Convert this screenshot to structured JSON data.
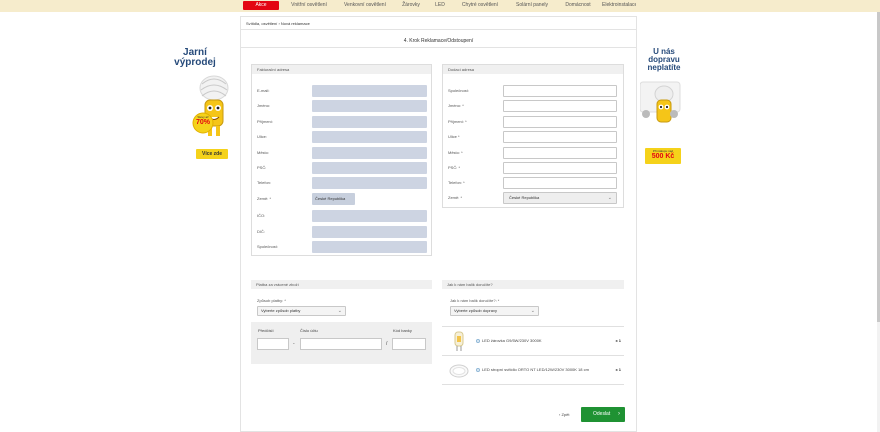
{
  "nav": {
    "items": [
      {
        "label": "Akce",
        "active": true
      },
      {
        "label": "Vnitřní osvětlení"
      },
      {
        "label": "Venkovní osvětlení"
      },
      {
        "label": "Žárovky"
      },
      {
        "label": "LED"
      },
      {
        "label": "Chytré osvětlení"
      },
      {
        "label": "Solární panely"
      },
      {
        "label": "Domácnost"
      },
      {
        "label": "Elektroinstalace"
      }
    ]
  },
  "breadcrumb": "Svítidla, osvětlení  ›  Nová reklamace",
  "step_title": "4. Krok Reklamace/Odstoupení",
  "billing": {
    "heading": "Fakturační adresa",
    "fields": [
      {
        "label": "E-mail:"
      },
      {
        "label": "Jméno:"
      },
      {
        "label": "Příjmení:"
      },
      {
        "label": "Ulice:"
      },
      {
        "label": "Město:"
      },
      {
        "label": "PSČ:"
      },
      {
        "label": "Telefon:"
      },
      {
        "label": "Země: *",
        "value": "České Republika"
      },
      {
        "label": "IČO:"
      },
      {
        "label": "DIČ:"
      },
      {
        "label": "Společnost:"
      }
    ]
  },
  "shipping": {
    "heading": "Dodací adresa",
    "fields": [
      {
        "label": "Společnost:"
      },
      {
        "label": "Jméno: *"
      },
      {
        "label": "Příjmení: *"
      },
      {
        "label": "Ulice *"
      },
      {
        "label": "Město: *"
      },
      {
        "label": "PSČ: *"
      },
      {
        "label": "Telefon: *"
      },
      {
        "label": "Země: *",
        "value": "České Republika"
      }
    ]
  },
  "payment": {
    "heading": "Platba za vrácené zboží",
    "method_label": "Způsob platby: *",
    "method_value": "Vyberte způsob platby",
    "prefix_label": "Předčíslí",
    "account_label": "Číslo účtu",
    "bank_label": "Kód banky",
    "dash": "-",
    "slash": "/"
  },
  "delivery": {
    "heading": "Jak k nám balík doručíte?",
    "method_label": "Jak k nám balík doručíte?: *",
    "method_value": "Vyberte způsob dopravy"
  },
  "products": [
    {
      "name": "LED žárovka G9/5W/230V 3000K",
      "qty": "x 1"
    },
    {
      "name": "LED stropní svítidlo ORTO NT LED/12W/230V 3000K 18 cm",
      "qty": "x 1"
    }
  ],
  "actions": {
    "back": "‹ Zpět",
    "submit": "Odeslat",
    "submit_arrow": "›"
  },
  "left_banner": {
    "title_line1": "Jarní",
    "title_line2": "výprodej",
    "badge_line1": "Slevy až",
    "badge_line2": "70%",
    "button": "Více zde"
  },
  "right_banner": {
    "title_line1": "U nás",
    "title_line2": "dopravu",
    "title_line3": "neplatíte",
    "badge_line1": "Při nákupu nad",
    "badge_line2": "500 Kč"
  },
  "colors": {
    "accent_red": "#e30613",
    "field_fill": "#cdd4e2",
    "submit_green": "#1f9233",
    "banner_blue": "#264a7a",
    "promo_yellow": "#f5d21a"
  }
}
